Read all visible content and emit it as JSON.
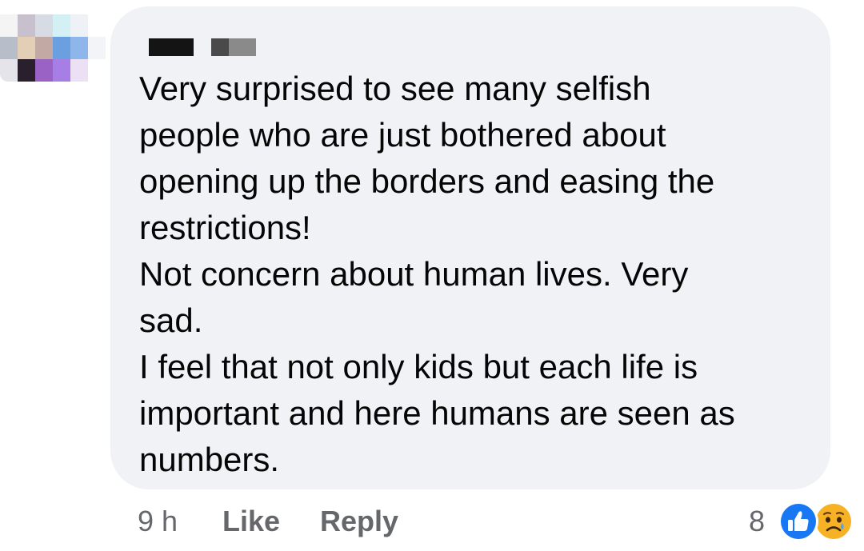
{
  "comment": {
    "author_redacted": true,
    "lines": [
      "Very surprised to see many selfish",
      "people who are just bothered about",
      "opening up the borders and easing the",
      "restrictions!",
      "Not concern about human lives. Very",
      "sad.",
      "I feel that not only kids but each life is",
      "important and here humans are seen as",
      "numbers."
    ]
  },
  "actions": {
    "timestamp": "9 h",
    "like_label": "Like",
    "reply_label": "Reply"
  },
  "reactions": {
    "count": "8",
    "icons": [
      "like-icon",
      "sad-icon"
    ]
  },
  "colors": {
    "bubble_background": "#f0f2f5",
    "text": "#050505",
    "secondary_text": "#65676b",
    "like_blue": "#1877f2",
    "sad_yellow": "#f7b125"
  }
}
